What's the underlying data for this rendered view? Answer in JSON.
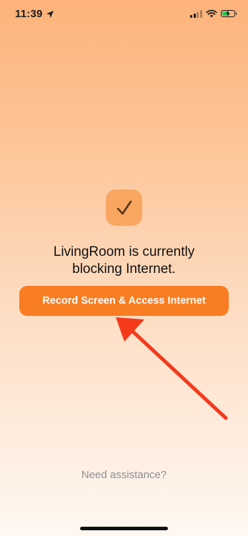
{
  "status_bar": {
    "time": "11:39",
    "location_icon": "location-arrow-icon",
    "signal_icon": "cellular-signal-icon",
    "wifi_icon": "wifi-icon",
    "battery_icon": "battery-charging-icon",
    "battery_color": "#34c759"
  },
  "main": {
    "badge_icon": "checkmark-icon",
    "message_line1": "LivingRoom is currently",
    "message_line2": "blocking Internet.",
    "primary_button_label": "Record Screen & Access Internet",
    "assist_link_label": "Need assistance?"
  },
  "annotation": {
    "arrow_icon": "red-pointer-arrow-icon",
    "arrow_color": "#f53a1c"
  },
  "colors": {
    "accent": "#f97d22",
    "badge_background": "#f9a660",
    "background_top": "#fdb37a",
    "background_bottom": "#fff8f2"
  }
}
